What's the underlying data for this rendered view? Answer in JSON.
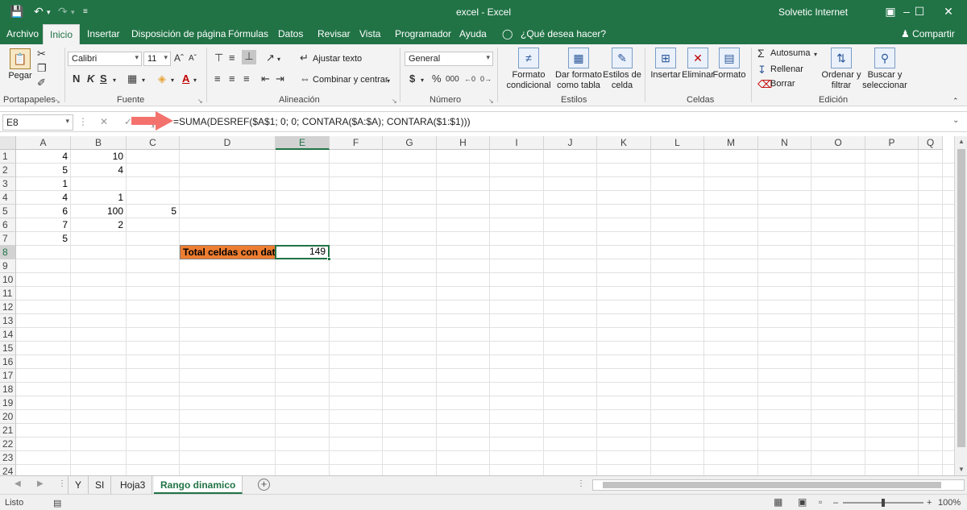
{
  "titlebar": {
    "title": "excel  -  Excel",
    "user": "Solvetic Internet",
    "bg_color": "#217346"
  },
  "tabs": {
    "items": [
      "Archivo",
      "Inicio",
      "Insertar",
      "Disposición de página",
      "Fórmulas",
      "Datos",
      "Revisar",
      "Vista",
      "Programador",
      "Ayuda"
    ],
    "active": "Inicio",
    "tellme": "¿Qué desea hacer?",
    "share": "Compartir"
  },
  "ribbon": {
    "clipboard": {
      "paste": "Pegar",
      "label": "Portapapeles"
    },
    "font": {
      "name": "Calibri",
      "size": "11",
      "bold": "N",
      "italic": "K",
      "underline": "S",
      "label": "Fuente"
    },
    "alignment": {
      "wrap": "Ajustar texto",
      "merge": "Combinar y centrar",
      "label": "Alineación"
    },
    "number": {
      "format": "General",
      "currency": "$",
      "percent": "%",
      "thousands": "000",
      "label": "Número"
    },
    "styles": {
      "conditional": [
        "Formato",
        "condicional"
      ],
      "astable": [
        "Dar formato",
        "como tabla"
      ],
      "cellstyles": [
        "Estilos de",
        "celda"
      ],
      "label": "Estilos"
    },
    "cells": {
      "insert": "Insertar",
      "delete": "Eliminar",
      "format": "Formato",
      "label": "Celdas"
    },
    "editing": {
      "autosum": "Autosuma",
      "fill": "Rellenar",
      "clear": "Borrar",
      "sort": [
        "Ordenar y",
        "filtrar"
      ],
      "find": [
        "Buscar y",
        "seleccionar"
      ],
      "label": "Edición"
    }
  },
  "formula_bar": {
    "namebox": "E8",
    "formula": "=SUMA(DESREF($A$1; 0; 0; CONTARA($A:$A); CONTARA($1:$1)))",
    "arrow_color": "#f4726e"
  },
  "grid": {
    "columns": [
      "A",
      "B",
      "C",
      "D",
      "E",
      "F",
      "G",
      "H",
      "I",
      "J",
      "K",
      "L",
      "M",
      "N",
      "O",
      "P",
      "Q"
    ],
    "rows": [
      "1",
      "2",
      "3",
      "4",
      "5",
      "6",
      "7",
      "8",
      "9",
      "10",
      "11",
      "12",
      "13",
      "14",
      "15",
      "16",
      "17",
      "18",
      "19",
      "20",
      "21",
      "22",
      "23",
      "24"
    ],
    "selected_column": "E",
    "selected_row": "8",
    "cells": [
      {
        "ref": "A1",
        "value": "4"
      },
      {
        "ref": "B1",
        "value": "10"
      },
      {
        "ref": "A2",
        "value": "5"
      },
      {
        "ref": "B2",
        "value": "4"
      },
      {
        "ref": "A3",
        "value": "1"
      },
      {
        "ref": "A4",
        "value": "4"
      },
      {
        "ref": "B4",
        "value": "1"
      },
      {
        "ref": "A5",
        "value": "6"
      },
      {
        "ref": "B5",
        "value": "100"
      },
      {
        "ref": "C5",
        "value": "5"
      },
      {
        "ref": "A6",
        "value": "7"
      },
      {
        "ref": "B6",
        "value": "2"
      },
      {
        "ref": "A7",
        "value": "5"
      }
    ],
    "label_cell": {
      "ref": "D8",
      "value": "Total celdas con datos",
      "fill": "#ed7d31"
    },
    "result_cell": {
      "ref": "E8",
      "value": "149"
    }
  },
  "sheets": {
    "items": [
      "Y",
      "SI",
      "Hoja3",
      "Rango dinamico"
    ],
    "active": "Rango dinamico"
  },
  "status": {
    "ready": "Listo",
    "zoom": "100%"
  }
}
